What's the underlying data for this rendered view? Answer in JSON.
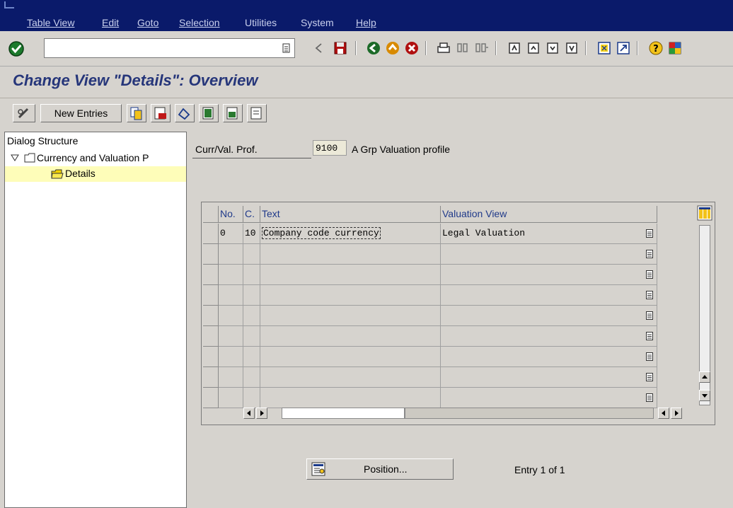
{
  "menu": {
    "items": [
      {
        "label": "Table View"
      },
      {
        "label": "Edit"
      },
      {
        "label": "Goto"
      },
      {
        "label": "Selection"
      },
      {
        "label": "Utilities"
      },
      {
        "label": "System"
      },
      {
        "label": "Help"
      }
    ]
  },
  "command_field": {
    "value": ""
  },
  "page_title": "Change View \"Details\": Overview",
  "app_toolbar": {
    "new_entries_label": "New Entries"
  },
  "dialog_structure": {
    "header": "Dialog Structure",
    "tree": [
      {
        "label": "Currency and Valuation P",
        "expanded": true
      },
      {
        "label": "Details",
        "selected": true
      }
    ]
  },
  "header_fields": {
    "curr_val_prof_label": "Curr/Val. Prof.",
    "curr_val_prof_value": "9100",
    "curr_val_prof_desc": "A Grp Valuation profile"
  },
  "table": {
    "columns": [
      {
        "label": "No."
      },
      {
        "label": "C."
      },
      {
        "label": "Text"
      },
      {
        "label": "Valuation View"
      }
    ],
    "rows": [
      {
        "no": "0",
        "c": "10",
        "text": "Company code currency",
        "valuation_view": "Legal Valuation"
      },
      {
        "no": "",
        "c": "",
        "text": "",
        "valuation_view": ""
      },
      {
        "no": "",
        "c": "",
        "text": "",
        "valuation_view": ""
      },
      {
        "no": "",
        "c": "",
        "text": "",
        "valuation_view": ""
      },
      {
        "no": "",
        "c": "",
        "text": "",
        "valuation_view": ""
      },
      {
        "no": "",
        "c": "",
        "text": "",
        "valuation_view": ""
      },
      {
        "no": "",
        "c": "",
        "text": "",
        "valuation_view": ""
      },
      {
        "no": "",
        "c": "",
        "text": "",
        "valuation_view": ""
      },
      {
        "no": "",
        "c": "",
        "text": "",
        "valuation_view": ""
      }
    ]
  },
  "position_button_label": "Position...",
  "entry_count": "Entry 1 of 1",
  "colors": {
    "menu_bg": "#0a1a6a",
    "title": "#26367a",
    "selected_tree_bg": "#fefdb9",
    "header_text": "#203a8a"
  }
}
